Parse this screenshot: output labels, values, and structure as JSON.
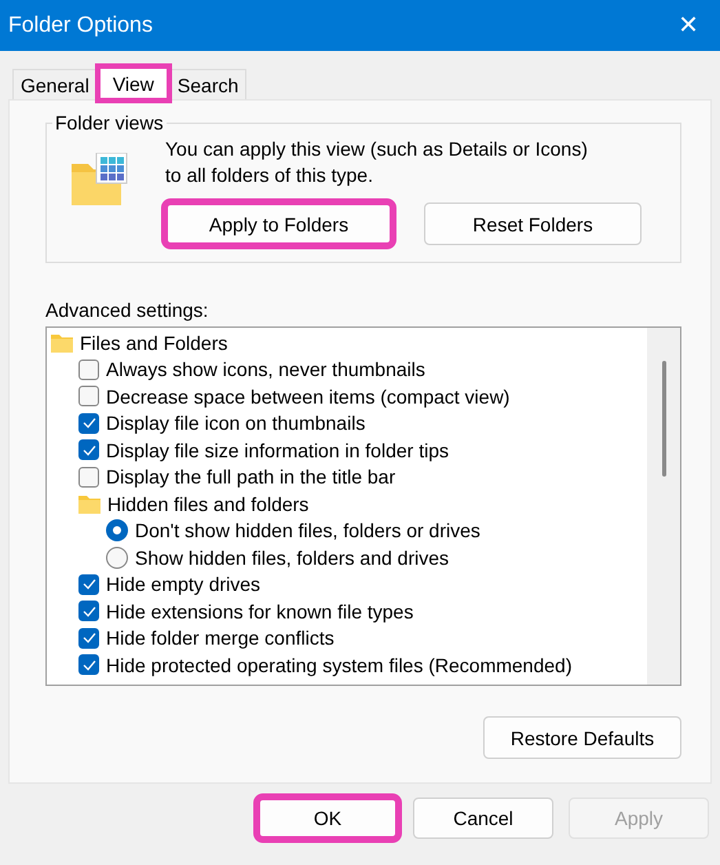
{
  "window": {
    "title": "Folder Options",
    "close": "✕"
  },
  "tabs": [
    {
      "label": "General",
      "selected": false,
      "highlighted": false
    },
    {
      "label": "View",
      "selected": true,
      "highlighted": true
    },
    {
      "label": "Search",
      "selected": false,
      "highlighted": false
    }
  ],
  "folder_views": {
    "title": "Folder views",
    "description": "You can apply this view (such as Details or Icons) to all folders of this type.",
    "buttons": [
      {
        "label": "Apply to Folders",
        "highlighted": true
      },
      {
        "label": "Reset Folders",
        "highlighted": false
      }
    ]
  },
  "advanced": {
    "label": "Advanced settings:",
    "items": [
      {
        "kind": "folder",
        "label": "Files and Folders",
        "children": [
          {
            "kind": "checkbox",
            "label": "Always show icons, never thumbnails",
            "checked": false
          },
          {
            "kind": "checkbox",
            "label": "Decrease space between items (compact view)",
            "checked": false
          },
          {
            "kind": "checkbox",
            "label": "Display file icon on thumbnails",
            "checked": true
          },
          {
            "kind": "checkbox",
            "label": "Display file size information in folder tips",
            "checked": true
          },
          {
            "kind": "checkbox",
            "label": "Display the full path in the title bar",
            "checked": false
          },
          {
            "kind": "folder",
            "label": "Hidden files and folders",
            "children": [
              {
                "kind": "radio",
                "label": "Don't show hidden files, folders or drives",
                "selected": true
              },
              {
                "kind": "radio",
                "label": "Show hidden files, folders and drives",
                "selected": false
              }
            ]
          },
          {
            "kind": "checkbox",
            "label": "Hide empty drives",
            "checked": true
          },
          {
            "kind": "checkbox",
            "label": "Hide extensions for known file types",
            "checked": true
          },
          {
            "kind": "checkbox",
            "label": "Hide folder merge conflicts",
            "checked": true
          },
          {
            "kind": "checkbox",
            "label": "Hide protected operating system files (Recommended)",
            "checked": true
          }
        ]
      }
    ],
    "restore_button": "Restore Defaults"
  },
  "buttons": [
    {
      "label": "OK",
      "disabled": false,
      "highlighted": true
    },
    {
      "label": "Cancel",
      "disabled": false,
      "highlighted": false
    },
    {
      "label": "Apply",
      "disabled": true,
      "highlighted": false
    }
  ]
}
